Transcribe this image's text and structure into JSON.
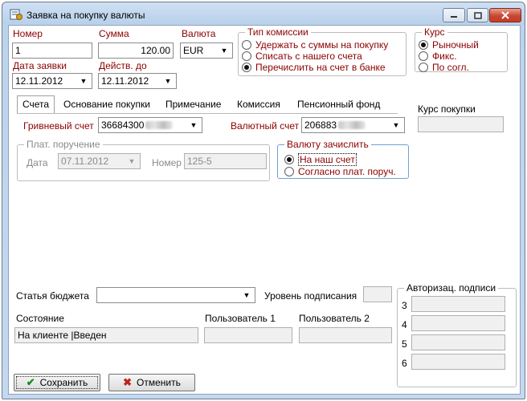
{
  "window": {
    "title": "Заявка на покупку валюты",
    "icon": "document-currency-icon"
  },
  "header": {
    "number_label": "Номер",
    "number_value": "1",
    "sum_label": "Сумма",
    "sum_value": "120.00",
    "currency_label": "Валюта",
    "currency_value": "EUR",
    "date_label": "Дата заявки",
    "date_value": "12.11.2012",
    "valid_label": "Действ. до",
    "valid_value": "12.11.2012"
  },
  "commission_type": {
    "title": "Тип комиссии",
    "options": [
      "Удержать с суммы на покупку",
      "Списать с нашего счета",
      "Перечислить на счет в банке"
    ],
    "selected_index": 2
  },
  "rate": {
    "title": "Курс",
    "options": [
      "Рыночный",
      "Фикс.",
      "По согл."
    ],
    "selected_index": 0
  },
  "tabs": [
    "Счета",
    "Основание покупки",
    "Примечание",
    "Комиссия",
    "Пенсионный фонд"
  ],
  "active_tab_index": 0,
  "purchase_rate": {
    "label": "Курс покупки",
    "value": ""
  },
  "accounts": {
    "hryvnia_label": "Гривневый счет",
    "hryvnia_value": "36684300",
    "currency_account_label": "Валютный счет",
    "currency_account_value": "206883"
  },
  "payment_order": {
    "title": "Плат. поручение",
    "date_label": "Дата",
    "date_value": "07.11.2012",
    "number_label": "Номер",
    "number_value": "125-5"
  },
  "credit_currency": {
    "title": "Валюту зачислить",
    "options": [
      "На наш счет",
      "Согласно плат. поруч."
    ],
    "selected_index": 0
  },
  "bottom": {
    "budget_article_label": "Статья бюджета",
    "budget_article_value": "",
    "sign_level_label": "Уровень подписания",
    "sign_level_value": "",
    "state_label": "Состояние",
    "state_value": "На клиенте |Введен",
    "user1_label": "Пользователь 1",
    "user1_value": "",
    "user2_label": "Пользователь 2",
    "user2_value": ""
  },
  "signatures": {
    "title": "Авторизац. подписи",
    "rows": [
      {
        "label": "3",
        "value": ""
      },
      {
        "label": "4",
        "value": ""
      },
      {
        "label": "5",
        "value": ""
      },
      {
        "label": "6",
        "value": ""
      }
    ]
  },
  "buttons": {
    "save": "Сохранить",
    "cancel": "Отменить"
  },
  "colors": {
    "label_red": "#8b0000",
    "title_gradient": "#b9d1ea",
    "close_red": "#c9462f"
  }
}
